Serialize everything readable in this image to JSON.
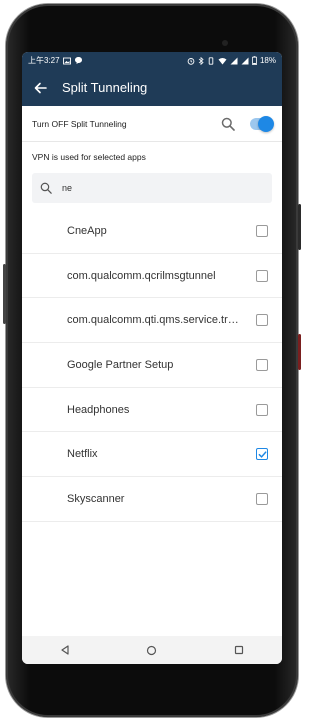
{
  "status_bar": {
    "time": "上午3:27",
    "battery": "18%"
  },
  "app_bar": {
    "title": "Split Tunneling"
  },
  "toggle_row": {
    "label": "Turn OFF Split Tunneling",
    "enabled": true
  },
  "subtitle": "VPN is used for selected apps",
  "search": {
    "value": "ne"
  },
  "apps": [
    {
      "name": "CneApp",
      "checked": false
    },
    {
      "name": "com.qualcomm.qcrilmsgtunnel",
      "checked": false
    },
    {
      "name": "com.qualcomm.qti.qms.service.tr…",
      "checked": false
    },
    {
      "name": "Google Partner Setup",
      "checked": false
    },
    {
      "name": "Headphones",
      "checked": false
    },
    {
      "name": "Netflix",
      "checked": true
    },
    {
      "name": "Skyscanner",
      "checked": false
    }
  ],
  "colors": {
    "appbar": "#1f3b57",
    "accent": "#1e88e5"
  },
  "icons": {
    "back": "arrow-back-icon",
    "search": "search-icon",
    "nav_back": "nav-back-icon",
    "nav_home": "nav-home-icon",
    "nav_recents": "nav-recents-icon"
  }
}
